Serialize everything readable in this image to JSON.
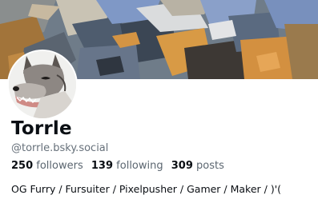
{
  "profile": {
    "display_name": "Torrle",
    "handle": "@torrle.bsky.social",
    "followers_count": "250",
    "followers_label": "followers",
    "following_count": "139",
    "following_label": "following",
    "posts_count": "309",
    "posts_label": "posts",
    "bio": "OG Furry / Fursuiter / Pixelpusher / Gamer / Maker / )'("
  },
  "colors": {
    "banner_base": "#6b7a8a",
    "banner_orange": "#d9953f",
    "banner_blue": "#7d96c4",
    "banner_dark": "#3a3633",
    "text_primary": "#0b0f14",
    "text_secondary": "#66707a"
  }
}
